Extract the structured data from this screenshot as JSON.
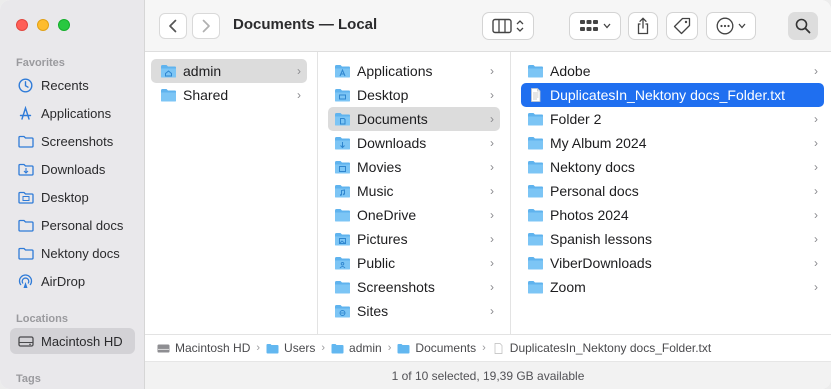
{
  "window": {
    "title": "Documents — Local"
  },
  "sidebar": {
    "favorites_header": "Favorites",
    "favorites": [
      {
        "label": "Recents",
        "icon": "clock-icon"
      },
      {
        "label": "Applications",
        "icon": "applications-icon"
      },
      {
        "label": "Screenshots",
        "icon": "folder-icon"
      },
      {
        "label": "Downloads",
        "icon": "downloads-folder-icon"
      },
      {
        "label": "Desktop",
        "icon": "desktop-folder-icon"
      },
      {
        "label": "Personal docs",
        "icon": "folder-icon"
      },
      {
        "label": "Nektony docs",
        "icon": "folder-icon"
      },
      {
        "label": "AirDrop",
        "icon": "airdrop-icon"
      }
    ],
    "locations_header": "Locations",
    "locations": [
      {
        "label": "Macintosh HD",
        "icon": "hard-drive-icon",
        "selected": true
      }
    ],
    "tags_header": "Tags"
  },
  "columns": {
    "col1": [
      "admin",
      "Shared"
    ],
    "col2": [
      "Applications",
      "Desktop",
      "Documents",
      "Downloads",
      "Movies",
      "Music",
      "OneDrive",
      "Pictures",
      "Public",
      "Screenshots",
      "Sites"
    ],
    "col3": [
      "Adobe",
      "DuplicatesIn_Nektony docs_Folder.txt",
      "Folder 2",
      "My Album 2024",
      "Nektony docs",
      "Personal docs",
      "Photos 2024",
      "Spanish lessons",
      "ViberDownloads",
      "Zoom"
    ]
  },
  "pathbar": [
    "Macintosh HD",
    "Users",
    "admin",
    "Documents",
    "DuplicatesIn_Nektony docs_Folder.txt"
  ],
  "status": "1 of 10 selected, 19,39 GB available",
  "colors": {
    "accent": "#1f6ff0",
    "folder": "#62b7f0",
    "sidebar_icon": "#2f7bd8"
  }
}
